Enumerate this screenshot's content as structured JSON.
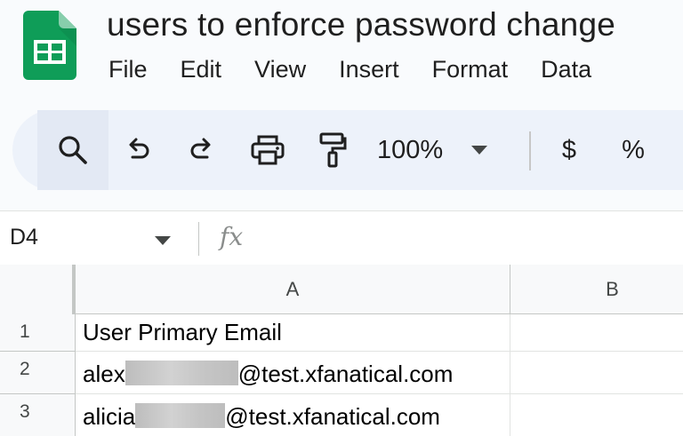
{
  "document": {
    "title": "users to enforce password change"
  },
  "menu": {
    "items": [
      "File",
      "Edit",
      "View",
      "Insert",
      "Format",
      "Data"
    ]
  },
  "toolbar": {
    "zoom": "100%",
    "currency_label": "$",
    "percent_label": "%",
    "icons": [
      "search-icon",
      "undo-icon",
      "redo-icon",
      "print-icon",
      "paint-format-icon",
      "dropdown-arrow-icon"
    ]
  },
  "formula_bar": {
    "cell_reference": "D4",
    "fx_label": "fx",
    "formula_value": ""
  },
  "grid": {
    "columns": [
      "A",
      "B"
    ],
    "rows": [
      "1",
      "2",
      "3"
    ],
    "cells": [
      {
        "prefix": "User Primary Email",
        "suffix": ""
      },
      {
        "prefix": "alex",
        "suffix": "@test.xfanatical.com"
      },
      {
        "prefix": "alicia",
        "suffix": "@test.xfanatical.com"
      }
    ]
  },
  "colors": {
    "brand_green": "#0f9d58",
    "toolbar_bg": "#edf2fa",
    "header_bg": "#f8f9fa",
    "grid_line": "#e1e3e1"
  }
}
